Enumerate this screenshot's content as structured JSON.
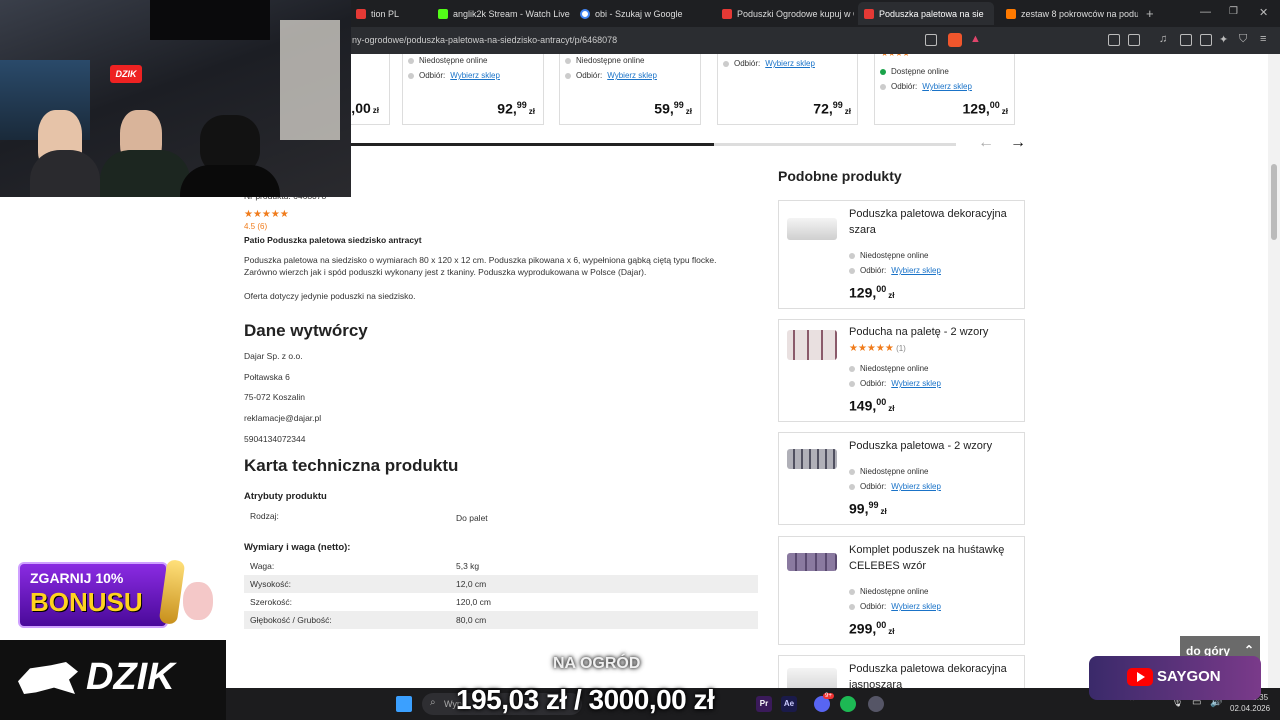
{
  "browser": {
    "tabs": [
      {
        "label": "tion PL",
        "color": "#e53935"
      },
      {
        "label": "anglik2k Stream - Watch Live o",
        "color": "#53fc18"
      },
      {
        "label": "obi - Szukaj w Google",
        "color": "#4285f4"
      },
      {
        "label": "Poduszki Ogrodowe kupuj w O",
        "color": "#e53935"
      },
      {
        "label": "Poduszka paletowa na sie",
        "color": "#e53935"
      },
      {
        "label": "zestaw 8 pokrowców na podu",
        "color": "#ff7a00"
      }
    ],
    "url": "ny-ogrodowe/poduszka-paletowa-na-siedzisko-antracyt/p/6468078"
  },
  "carousel": {
    "cards": [
      {
        "status": "",
        "pickup_label": "",
        "pickup_link": "",
        "price_main": "5,00",
        "currency": "zł"
      },
      {
        "status": "Niedostępne online",
        "pickup_label": "Odbiór:",
        "pickup_link": "Wybierz sklep",
        "price_main": "92,",
        "price_sup": "99",
        "currency": "zł"
      },
      {
        "status": "Niedostępne online",
        "pickup_label": "Odbiór:",
        "pickup_link": "Wybierz sklep",
        "price_main": "59,",
        "price_sup": "99",
        "currency": "zł"
      },
      {
        "status": "",
        "pickup_label": "Odbiór:",
        "pickup_link": "Wybierz sklep",
        "price_main": "72,",
        "price_sup": "99",
        "currency": "zł"
      },
      {
        "status": "Dostępne online",
        "pickup_label": "Odbiór:",
        "pickup_link": "Wybierz sklep",
        "price_main": "129,",
        "price_sup": "00",
        "currency": "zł"
      }
    ],
    "progress": 0.66,
    "prev_arrow": "←",
    "next_arrow": "→"
  },
  "product": {
    "number_label": "Nr produktu: 6468078",
    "rating_stars": "★★★★★",
    "rating_text": "4.5 (6)",
    "name": "Patio Poduszka paletowa siedzisko antracyt",
    "description_1": "Poduszka paletowa na siedzisko o wymiarach 80 x 120 x 12 cm. Poduszka pikowana x 6, wypełniona gąbką ciętą typu flocke.",
    "description_2": "Zarówno wierzch jak i spód poduszki wykonany jest z tkaniny. Poduszka wyprodukowana w Polsce (Dajar).",
    "offer_note": "Oferta dotyczy jedynie poduszki na siedzisko."
  },
  "manufacturer": {
    "heading": "Dane wytwórcy",
    "company": "Dajar Sp. z o.o.",
    "street": "Połtawska 6",
    "city": "75-072 Koszalin",
    "email": "reklamacje@dajar.pl",
    "code": "5904134072344"
  },
  "tech": {
    "heading": "Karta techniczna produktu",
    "attributes_heading": "Atrybuty produktu",
    "attributes": [
      {
        "key": "Rodzaj:",
        "value": "Do palet"
      }
    ],
    "dimensions_heading": "Wymiary i waga (netto):",
    "dimensions": [
      {
        "key": "Waga:",
        "value": "5,3 kg"
      },
      {
        "key": "Wysokość:",
        "value": "12,0 cm"
      },
      {
        "key": "Szerokość:",
        "value": "120,0 cm"
      },
      {
        "key": "Głębokość / Grubość:",
        "value": "80,0 cm"
      }
    ]
  },
  "similar": {
    "heading": "Podobne produkty",
    "items": [
      {
        "name": "Poduszka paletowa dekoracyjna szara",
        "rating": "",
        "reviews": "",
        "status": "Niedostępne online",
        "pickup_label": "Odbiór:",
        "pickup_link": "Wybierz sklep",
        "price_main": "129,",
        "price_sup": "00",
        "currency": "zł",
        "img_color": "#d8d8d8"
      },
      {
        "name": "Poducha na paletę - 2 wzory",
        "rating": "★★★★★",
        "reviews": "(1)",
        "status": "Niedostępne online",
        "pickup_label": "Odbiór:",
        "pickup_link": "Wybierz sklep",
        "price_main": "149,",
        "price_sup": "00",
        "currency": "zł",
        "img_color": "#c9b3b3"
      },
      {
        "name": "Poduszka paletowa - 2 wzory",
        "rating": "",
        "reviews": "",
        "status": "Niedostępne online",
        "pickup_label": "Odbiór:",
        "pickup_link": "Wybierz sklep",
        "price_main": "99,",
        "price_sup": "99",
        "currency": "zł",
        "img_color": "#9a9aa0"
      },
      {
        "name": "Komplet poduszek na huśtawkę CELEBES wzór",
        "rating": "",
        "reviews": "",
        "status": "Niedostępne online",
        "pickup_label": "Odbiór:",
        "pickup_link": "Wybierz sklep",
        "price_main": "299,",
        "price_sup": "00",
        "currency": "zł",
        "img_color": "#7a6a8a"
      },
      {
        "name": "Poduszka paletowa dekoracyjna jasnoszara",
        "rating": "",
        "reviews": "",
        "status": "",
        "pickup_label": "",
        "pickup_link": "",
        "price_main": "",
        "price_sup": "",
        "currency": "",
        "img_color": "#e0e0e0"
      }
    ]
  },
  "overlays": {
    "bonus_line1": "ZGARNIJ 10%",
    "bonus_line2": "BONUSU",
    "dzik_logo": "DZIK",
    "dzik_small": "DZIK",
    "bottom_caption": "NA OGRÓD",
    "ticker": "195,03 zł / 3000,00 zł",
    "saygon": "SAYGON",
    "back_to_top": "do góry",
    "search_placeholder": "Wyp"
  },
  "taskbar": {
    "time": "18:35",
    "date": "02.04.2026",
    "discord_badge": "9+"
  }
}
